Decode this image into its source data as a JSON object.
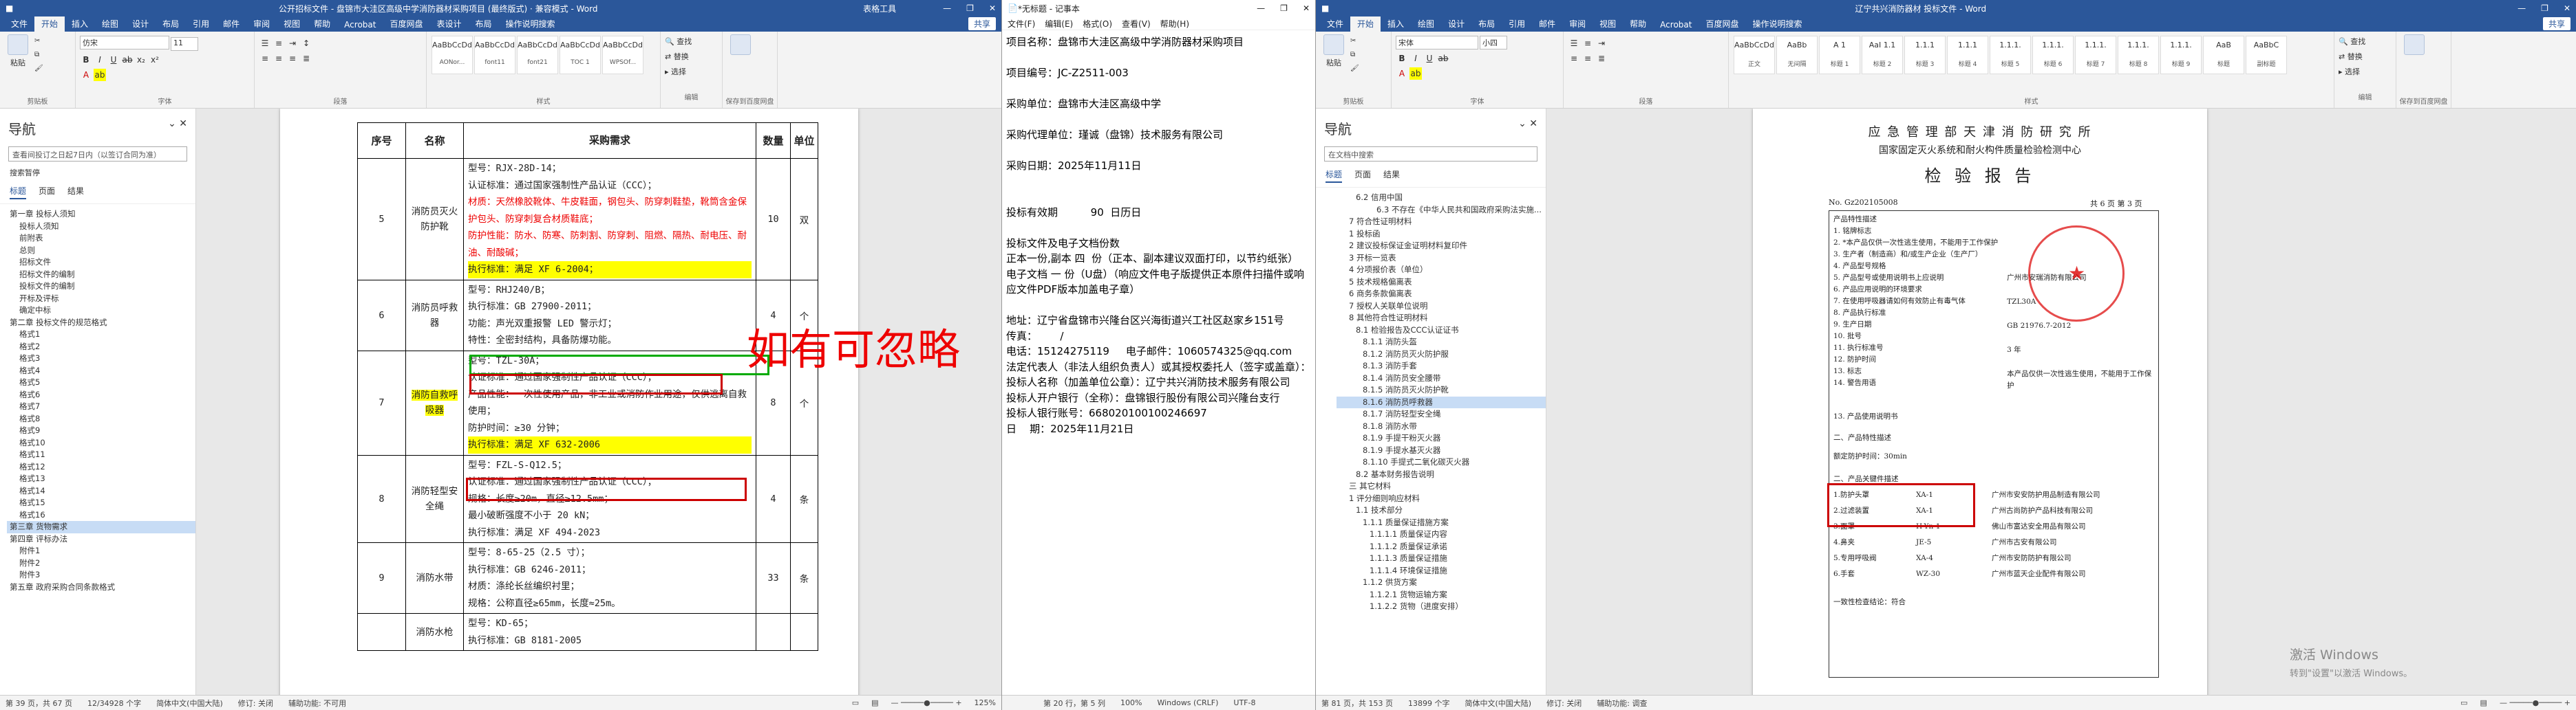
{
  "win1": {
    "title": "公开招标文件 - 盘锦市大洼区高级中学消防器材采购项目 (最终版式) · 兼容模式 - Word",
    "ctx_tab": "表格工具",
    "tabs": [
      "文件",
      "开始",
      "插入",
      "绘图",
      "设计",
      "布局",
      "引用",
      "邮件",
      "审阅",
      "视图",
      "帮助",
      "Acrobat",
      "百度网盘",
      "表设计",
      "布局",
      "操作说明搜索"
    ],
    "share": "共享",
    "groups": [
      "剪贴板",
      "字体",
      "段落",
      "样式",
      "编辑",
      "保存到百度网盘"
    ],
    "paste": "粘贴",
    "font_name": "仿宋",
    "font_size": "11",
    "styles": [
      {
        "preview": "AaBbCcDd",
        "name": "AONor..."
      },
      {
        "preview": "AaBbCcDd",
        "name": "font11"
      },
      {
        "preview": "AaBbCcDd",
        "name": "font21"
      },
      {
        "preview": "AaBbCcDd",
        "name": "TOC 1"
      },
      {
        "preview": "AaBbCcDd",
        "name": "WPSOf..."
      }
    ],
    "edit": [
      "查找",
      "替换",
      "选择"
    ],
    "nav": {
      "title": "导航",
      "search": "查看间投订之日起7日内（以签订合同为准）",
      "search_hint": "搜索暂停",
      "tabs": [
        "标题",
        "页面",
        "结果"
      ],
      "items": [
        "第一章 投标人须知",
        "投标人须知",
        "前附表",
        "总则",
        "招标文件",
        "招标文件的编制",
        "投标文件的编制",
        "开标及评标",
        "确定中标",
        "第二章 投标文件的规范格式",
        "格式1",
        "格式2",
        "格式3",
        "格式4",
        "格式5",
        "格式6",
        "格式7",
        "格式8",
        "格式9",
        "格式10",
        "格式11",
        "格式12",
        "格式13",
        "格式14",
        "格式15",
        "格式16",
        "第三章 货物需求",
        "第四章 评标办法",
        "附件1",
        "附件2",
        "附件3",
        "第五章 政府采购合同条款格式"
      ],
      "selected": 26
    },
    "table": {
      "headers": [
        "序号",
        "名称",
        "采购需求",
        "数量",
        "单位"
      ],
      "rows": [
        {
          "no": "5",
          "name": "消防员灭火防护靴",
          "qty": "10",
          "unit": "双",
          "req": [
            "型号：RJX-28D-14；",
            "认证标准：通过国家强制性产品认证（CCC）；",
            "材质：天然橡胶靴体、牛皮鞋面，钢包头、防穿刺鞋垫，靴筒含金保护包头、防穿刺复合材质鞋底；",
            "防护性能：防水、防寒、防刺割、防穿刺、阻燃、隔热、耐电压、耐油、耐酸碱；",
            "执行标准：满足 XF 6-2004；"
          ]
        },
        {
          "no": "6",
          "name": "消防员呼救器",
          "qty": "4",
          "unit": "个",
          "req": [
            "型号：RHJ240/B；",
            "执行标准：GB 27900-2011；",
            "功能：声光双重报警 LED 警示灯；",
            "特性：全密封结构，具备防爆功能。"
          ]
        },
        {
          "no": "7",
          "name": "消防自救呼吸器",
          "qty": "8",
          "unit": "个",
          "req": [
            "型号：TZL-30A；",
            "认证标准：通过国家强制性产品认证（CCC）；",
            "产品性能：一次性使用产品，非工业或消防作业用途，仅供逃离自救使用；",
            "防护时间：≥30 分钟；",
            "执行标准：满足 XF 632-2006"
          ]
        },
        {
          "no": "8",
          "name": "消防轻型安全绳",
          "qty": "4",
          "unit": "条",
          "req": [
            "型号：FZL-S-Q12.5；",
            "认证标准：通过国家强制性产品认证（CCC）；",
            "规格：长度≥20m，直径≥12.5mm；",
            "最小破断强度不小于 20 kN；",
            "执行标准：满足 XF 494-2023"
          ]
        },
        {
          "no": "9",
          "name": "消防水带",
          "qty": "33",
          "unit": "条",
          "req": [
            "型号：8-65-25（2.5 寸）；",
            "执行标准：GB 6246-2011；",
            "材质：涤纶长丝编织衬里；",
            "规格：公称直径≥65mm，长度≈25m。"
          ]
        },
        {
          "no": "",
          "name": "消防水枪",
          "qty": "",
          "unit": "",
          "req": [
            "型号：KD-65；",
            "执行标准：GB 8181-2005"
          ]
        }
      ]
    },
    "note": "如有可忽略",
    "status": [
      "第 39 页，共 67 页",
      "12/34928 个字",
      "简体中文(中国大陆)",
      "修订: 关闭",
      "辅助功能: 不可用"
    ],
    "zoom": "125%"
  },
  "win2": {
    "title": "*无标题 - 记事本",
    "menu": [
      "文件(F)",
      "编辑(E)",
      "格式(O)",
      "查看(V)",
      "帮助(H)"
    ],
    "lines": [
      "项目名称：盘锦市大洼区高级中学消防器材采购项目",
      "",
      "项目编号：JC-Z2511-003",
      "",
      "采购单位：盘锦市大洼区高级中学",
      "",
      "采购代理单位：瑾诚（盘锦）技术服务有限公司",
      "",
      "采购日期：2025年11月11日",
      "",
      "",
      "投标有效期          90  日历日",
      "",
      "投标文件及电子文档份数",
      "正本一份,副本 四  份（正本、副本建议双面打印，以节约纸张）",
      "电子文档 一 份（U盘）（响应文件电子版提供正本原件扫描件或响应文件PDF版本加盖电子章）",
      "",
      "地址：辽宁省盘锦市兴隆台区兴海街道兴工社区赵家乡151号      传真：       /",
      "电话：15124275119     电子邮件：1060574325@qq.com",
      "法定代表人（非法人组织负责人）或其授权委托人（签字或盖章）：",
      "投标人名称（加盖单位公章）：辽宁共兴消防技术服务有限公司",
      "投标人开户银行（全称）：盘锦银行股份有限公司兴隆台支行",
      "投标人银行账号：668020100100246697",
      "日    期：2025年11月21日"
    ],
    "status": [
      "第 20 行，第 5 列",
      "100%",
      "Windows (CRLF)",
      "UTF-8"
    ]
  },
  "win3": {
    "title": "辽宁共兴消防器材 投标文件 - Word",
    "tabs": [
      "文件",
      "开始",
      "插入",
      "绘图",
      "设计",
      "布局",
      "引用",
      "邮件",
      "审阅",
      "视图",
      "帮助",
      "Acrobat",
      "百度网盘",
      "操作说明搜索"
    ],
    "share": "共享",
    "font_name": "宋体",
    "font_size": "小四",
    "styles": [
      {
        "preview": "AaBbCcDd",
        "name": "正文"
      },
      {
        "preview": "AaBb",
        "name": "无间隔"
      },
      {
        "preview": "A 1",
        "name": "标题 1"
      },
      {
        "preview": "AaI 1.1",
        "name": "标题 2"
      },
      {
        "preview": "1.1.1",
        "name": "标题 3"
      },
      {
        "preview": "1.1.1",
        "name": "标题 4"
      },
      {
        "preview": "1.1.1.",
        "name": "标题 5"
      },
      {
        "preview": "1.1.1.",
        "name": "标题 6"
      },
      {
        "preview": "1.1.1.",
        "name": "标题 7"
      },
      {
        "preview": "1.1.1.",
        "name": "标题 8"
      },
      {
        "preview": "1.1.1.",
        "name": "标题 9"
      },
      {
        "preview": "AaB",
        "name": "标题"
      },
      {
        "preview": "AaBbC",
        "name": "副标题"
      }
    ],
    "nav": {
      "title": "导航",
      "search": "在文档中搜索",
      "tabs": [
        "标题",
        "页面",
        "结果"
      ],
      "items": [
        "6.2 信用中国",
        "6.3 不存在《中华人民共和国政府采购法实施...",
        "7 符合性证明材料",
        "1 投标函",
        "2 建议投标保证金证明材料复印件",
        "3 开标一览表",
        "4 分项报价表（单位）",
        "5 技术规格偏离表",
        "6 商务条款偏离表",
        "7 授权人关联单位说明",
        "8 其他符合性证明材料",
        "8.1 检验报告及CCC认证证书",
        "8.1.1 消防头盔",
        "8.1.2 消防员灭火防护服",
        "8.1.3 消防手套",
        "8.1.4 消防员安全腰带",
        "8.1.5 消防员灭火防护靴",
        "8.1.6 消防员呼救器",
        "8.1.7 消防轻型安全绳",
        "8.1.8 消防水带",
        "8.1.9 手提干粉灭火器",
        "8.1.9 手提水基灭火器",
        "8.1.10 手提式二氧化碳灭火器",
        "8.2 基本财务报告说明",
        "三 其它材料",
        "1 评分细则响应材料",
        "1.1 技术部分",
        "1.1.1 质量保证措施方案",
        "1.1.1.1 质量保证内容",
        "1.1.1.2 质量保证承诺",
        "1.1.1.3 质量保证措施",
        "1.1.1.4 环境保证措施",
        "1.1.2 供货方案",
        "1.1.2.1 货物运输方案",
        "1.1.2.2 货物（进度安排）"
      ],
      "selected": 17
    },
    "report": {
      "org": "应 急 管 理 部 天 津 消 防 研 究 所",
      "center": "国家固定灭火系统和耐火构件质量检验检测中心",
      "title": "检 验 报 告",
      "no": "No. Gz202105008",
      "page": "共 6 页 第 3 页",
      "section1": "产品特性描述",
      "items": [
        "1. 铭牌标志",
        "2. *本产品仅供一次性逃生使用，不能用于工作保护",
        "3. 生产者（制造商）和/或生产企业（生产厂）",
        "4. 产品型号规格",
        "5. 产品型号或使用说明书上应说明",
        "6. 产品应用说明的环境要求",
        "7. 在使用呼吸器请如何有效防止有毒气体",
        "8. 产品执行标准",
        "9. 生产日期",
        "10. 批号",
        "11. 执行标准号",
        "12. 防护时间",
        "13. 标志",
        "14. 警告用语"
      ],
      "values": [
        "广州市安瑞消防有限公司",
        "TZL30A",
        "GB 21976.7-2012",
        "3 年",
        "本产品仅供一次性逃生使用，不能用于工作保护"
      ],
      "section2": "13. 产品使用说明书",
      "spec_head": "二、产品特性描述",
      "spec_val": "额定防护时间：30min",
      "section3": "二、产品关键件描述",
      "parts": [
        {
          "n": "1.防护头罩",
          "m": "XA-1",
          "s": "广州市安安防护用品制造有限公司"
        },
        {
          "n": "2.过滤装置",
          "m": "XA-1",
          "s": "广州古尚防护产品科技有限公司"
        },
        {
          "n": "3.面罩",
          "m": "H-Yn-1",
          "s": "佛山市富达安全用品有限公司"
        },
        {
          "n": "4.鼻夹",
          "m": "JE-5",
          "s": "广州市古安有限公司"
        },
        {
          "n": "5.专用呼吸阀",
          "m": "XA-4",
          "s": "广州市安防防护有限公司"
        },
        {
          "n": "6.手套",
          "m": "WZ-30",
          "s": "广州市蓝天企业配件有限公司"
        }
      ],
      "footer": "一致性检查结论：符合"
    },
    "watermark": "激活 Windows",
    "watermark_sub": "转到\"设置\"以激活 Windows。",
    "status": [
      "第 81 页，共 153 页",
      "13899 个字",
      "简体中文(中国大陆)",
      "修订: 关闭",
      "辅助功能: 调查"
    ]
  }
}
